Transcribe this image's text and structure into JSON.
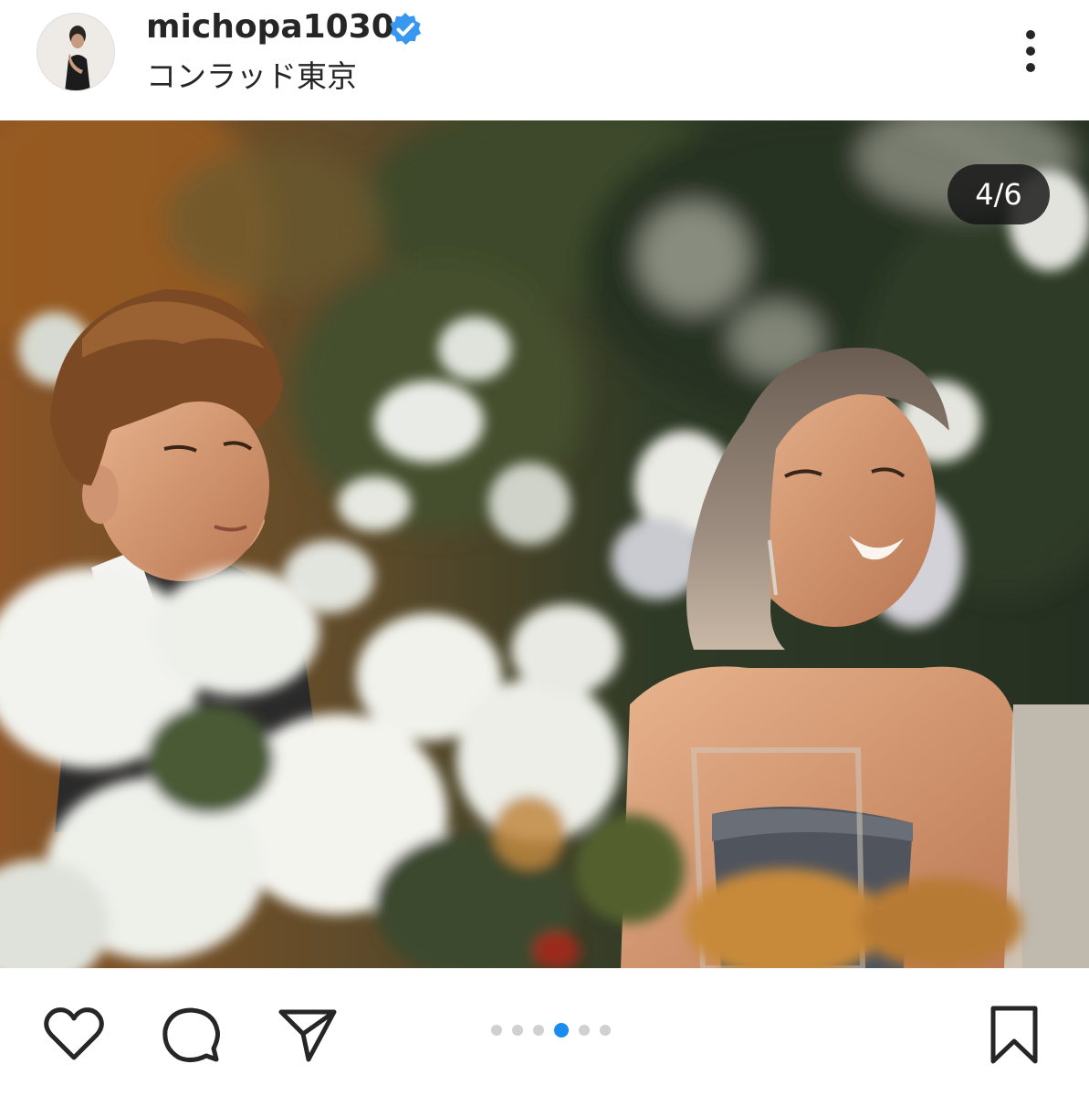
{
  "post": {
    "username": "michopa1030",
    "verified": true,
    "location": "コンラッド東京"
  },
  "carousel": {
    "counter": "4/6",
    "current": 4,
    "total": 6,
    "dot_count": 6,
    "active_dot_index": 3
  },
  "colors": {
    "verified_blue": "#3897f0",
    "active_dot": "#1a8cf0",
    "inactive_dot": "#d0d0d0",
    "text": "#262626"
  },
  "icons": {
    "like": "heart-outline-icon",
    "comment": "speech-bubble-icon",
    "share": "paper-plane-icon",
    "save": "bookmark-outline-icon",
    "more": "vertical-ellipsis-icon",
    "verified": "verified-badge-icon"
  }
}
